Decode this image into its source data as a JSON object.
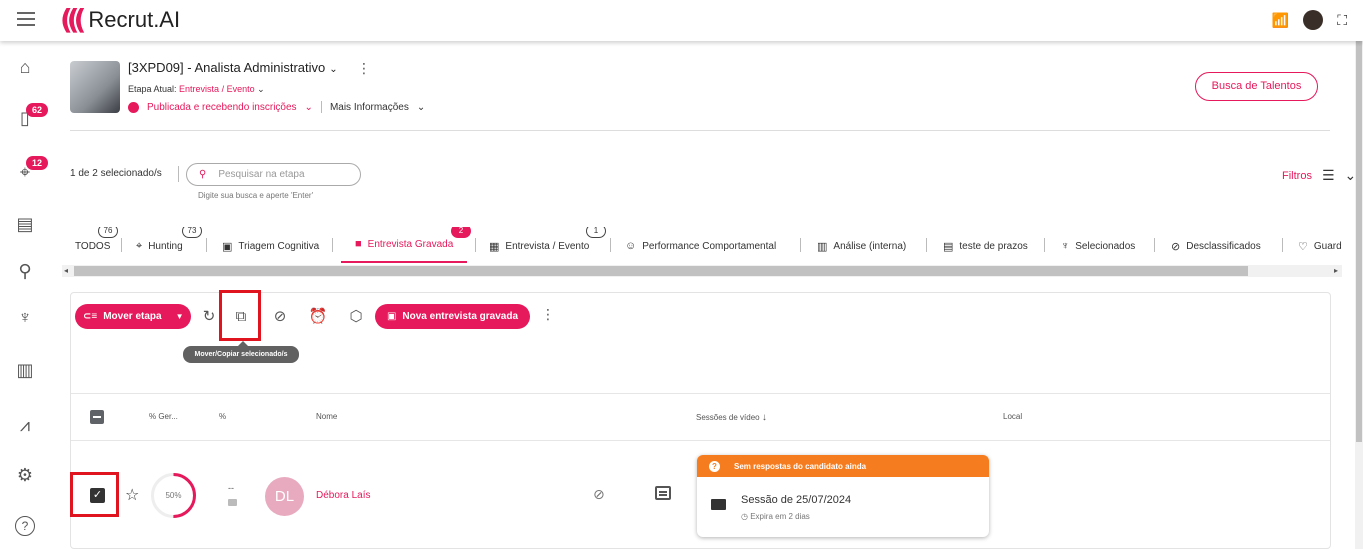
{
  "app": {
    "logo": "Recrut.AI"
  },
  "sidebar": {
    "items": [
      {
        "icon": "home-icon",
        "glyph": "⌂"
      },
      {
        "icon": "clipboard-icon",
        "glyph": "📋",
        "badge": "62"
      },
      {
        "icon": "crosshair-icon",
        "glyph": "⊕",
        "badge": "12"
      },
      {
        "icon": "book-icon",
        "glyph": "📖"
      },
      {
        "icon": "search-icon",
        "glyph": "⚲"
      },
      {
        "icon": "trophy-icon",
        "glyph": "🏆"
      },
      {
        "icon": "bar-chart-icon",
        "glyph": "📊"
      },
      {
        "icon": "trend-icon",
        "glyph": "〰"
      },
      {
        "icon": "settings-icon",
        "glyph": "⚙"
      },
      {
        "icon": "help-icon",
        "glyph": "?"
      }
    ]
  },
  "job": {
    "title": "[3XPD09] - Analista Administrativo",
    "stage_label": "Etapa Atual: ",
    "stage_value": "Entrevista / Evento",
    "status": "Publicada e recebendo inscrições",
    "more_info": "Mais Informações",
    "talent_button": "Busca de Talentos"
  },
  "filterbar": {
    "selected": "1 de 2 selecionado/s",
    "search_placeholder": "Pesquisar na etapa",
    "search_hint": "Digite sua busca e aperte 'Enter'",
    "filters": "Filtros"
  },
  "tabs": [
    {
      "label": "TODOS",
      "badge": "76"
    },
    {
      "label": "Hunting",
      "badge": "73"
    },
    {
      "label": "Triagem Cognitiva"
    },
    {
      "label": "Entrevista Gravada",
      "badge": "2",
      "active": true
    },
    {
      "label": "Entrevista / Evento",
      "badge": "1"
    },
    {
      "label": "Performance Comportamental"
    },
    {
      "label": "Análise (interna)"
    },
    {
      "label": "teste de prazos"
    },
    {
      "label": "Selecionados"
    },
    {
      "label": "Desclassificados"
    },
    {
      "label": "Guard"
    }
  ],
  "toolbar": {
    "move_label": "Mover etapa",
    "new_label": "Nova entrevista gravada",
    "tooltip": "Mover/Copiar selecionado/s"
  },
  "table": {
    "headers": {
      "ger": "% Ger...",
      "pct": "%",
      "name": "Nome",
      "sessions": "Sessões de vídeo",
      "local": "Local"
    },
    "rows": [
      {
        "score": 50,
        "score_label": "50%",
        "pct": "--",
        "initials": "DL",
        "name": "Débora Laís",
        "session_status": "Sem respostas do candidato ainda",
        "session_title": "Sessão de 25/07/2024",
        "session_expiry": "Expira em 2 dias"
      }
    ]
  },
  "colors": {
    "accent": "#e5195b",
    "warning": "#f57c1f"
  }
}
